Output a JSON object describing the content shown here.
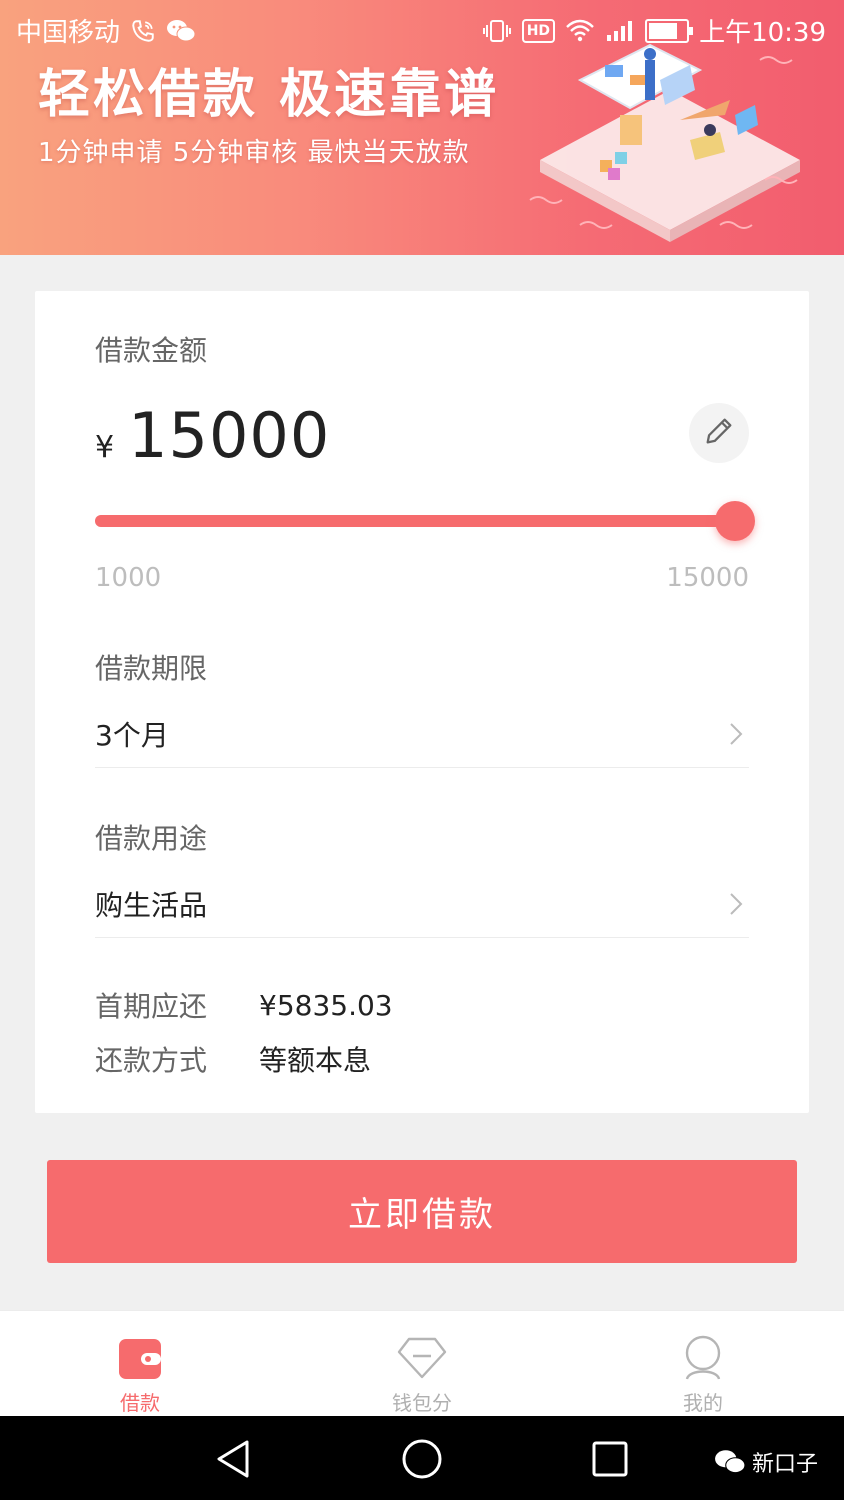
{
  "status_bar": {
    "carrier": "中国移动",
    "time": "上午10:39",
    "hd_label": "HD",
    "icons": [
      "phone-call-icon",
      "wechat-icon",
      "vibrate-icon",
      "hd-icon",
      "wifi-icon",
      "signal-icon",
      "battery-icon"
    ]
  },
  "banner": {
    "title": "轻松借款 极速靠谱",
    "subtitle": "1分钟申请  5分钟审核  最快当天放款"
  },
  "loan": {
    "amount_label": "借款金额",
    "currency": "¥",
    "amount": "15000",
    "slider_min": "1000",
    "slider_max": "15000",
    "slider_fraction": 1.0,
    "term_label": "借款期限",
    "term_value": "3个月",
    "purpose_label": "借款用途",
    "purpose_value": "购生活品",
    "first_payment_label": "首期应还",
    "first_payment_value": "¥5835.03",
    "repay_method_label": "还款方式",
    "repay_method_value": "等额本息"
  },
  "cta": {
    "label": "立即借款"
  },
  "tabs": [
    {
      "label": "借款",
      "icon": "wallet-icon",
      "active": true
    },
    {
      "label": "钱包分",
      "icon": "diamond-icon",
      "active": false
    },
    {
      "label": "我的",
      "icon": "user-icon",
      "active": false
    }
  ],
  "watermark": {
    "text": "新口子"
  },
  "colors": {
    "accent": "#f66b6d",
    "banner_start": "#f9a27e",
    "banner_end": "#f25d6e"
  }
}
